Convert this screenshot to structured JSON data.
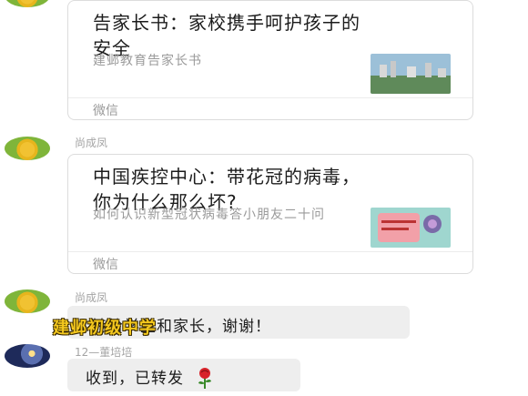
{
  "messages": [
    {
      "type": "link-card",
      "title": "告家长书：家校携手呵护孩子的安全",
      "description": "建邺教育告家长书",
      "source": "微信"
    },
    {
      "type": "link-card",
      "sender": "尚成凤",
      "title": "中国疾控中心：带花冠的病毒，你为什么那么坏?",
      "description": "如何认识新型冠状病毒答小朋友二十问",
      "source": "微信"
    },
    {
      "type": "text",
      "sender": "尚成凤",
      "text": "转给学生和家长，谢谢！"
    },
    {
      "type": "text",
      "sender": "12—董培培",
      "text": "收到，已转发",
      "emoji": "rose-icon"
    }
  ],
  "watermark": "建邺初级中学",
  "colors": {
    "watermark": "#f4c81e",
    "bubble": "#eeeeee"
  }
}
